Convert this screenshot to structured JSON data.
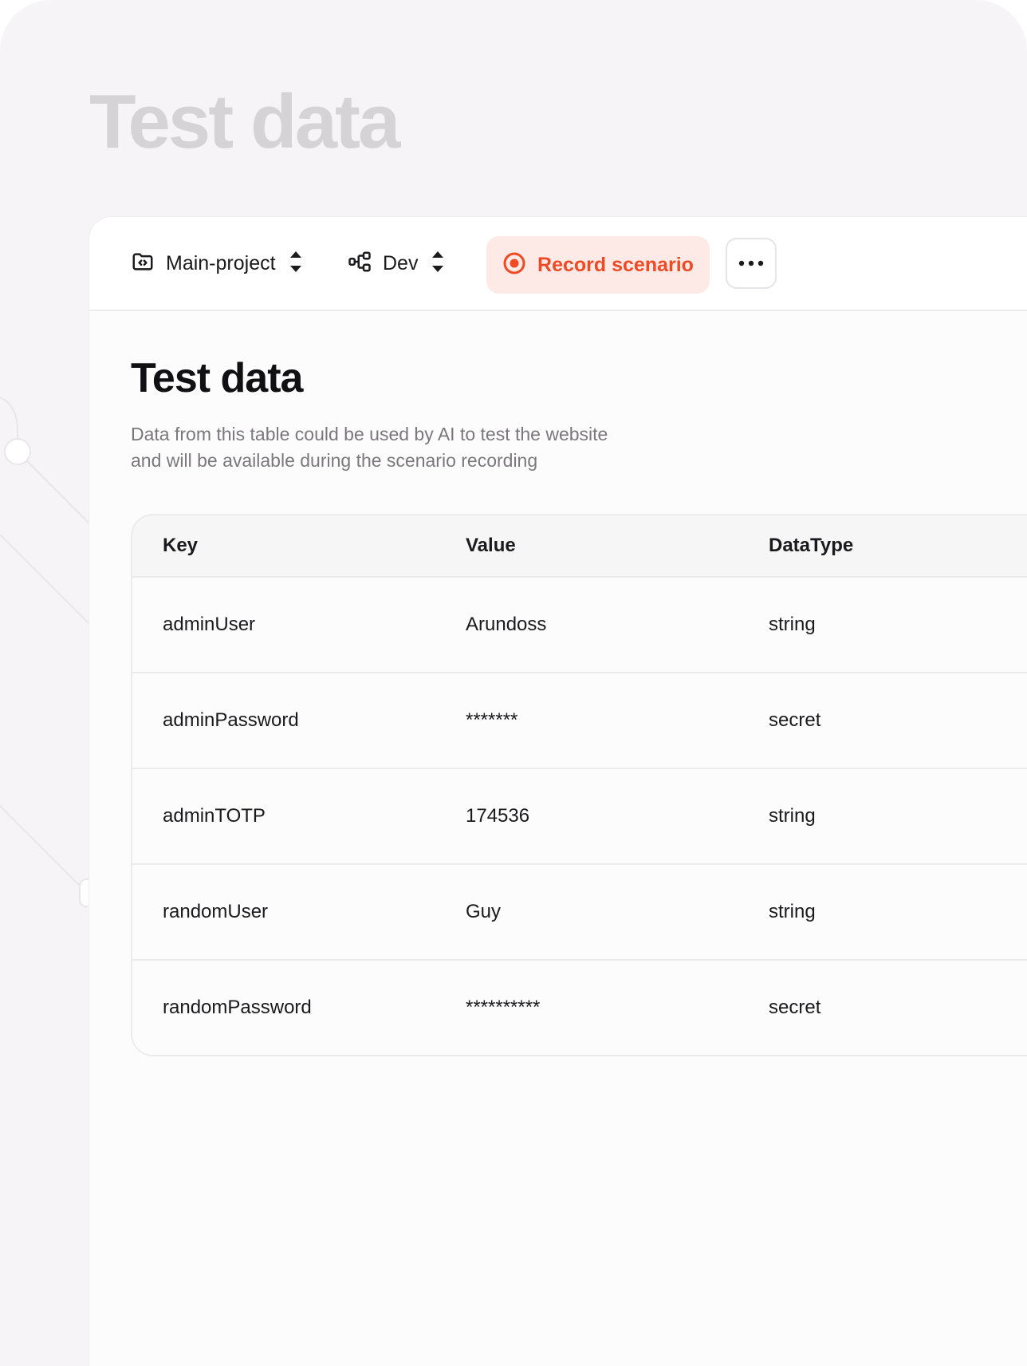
{
  "hero": {
    "title": "Test data"
  },
  "toolbar": {
    "project": {
      "label": "Main-project",
      "icon": "folder-code-icon"
    },
    "environment": {
      "label": "Dev",
      "icon": "workflow-icon"
    },
    "record": {
      "label": "Record scenario",
      "icon": "record-icon",
      "color": "#ef4a23",
      "background": "#fde9e6"
    },
    "more": {
      "icon": "more-horizontal-icon"
    }
  },
  "main": {
    "title": "Test data",
    "description_line1": "Data from this table could be used  by AI to test the website",
    "description_line2": "and will be available during the scenario recording"
  },
  "table": {
    "headers": [
      "Key",
      "Value",
      "DataType"
    ],
    "rows": [
      [
        "adminUser",
        "Arundoss",
        "string"
      ],
      [
        "adminPassword",
        "*******",
        "secret"
      ],
      [
        "adminTOTP",
        "174536",
        "string"
      ],
      [
        "randomUser",
        "Guy",
        "string"
      ],
      [
        "randomPassword",
        "**********",
        "secret"
      ]
    ]
  }
}
